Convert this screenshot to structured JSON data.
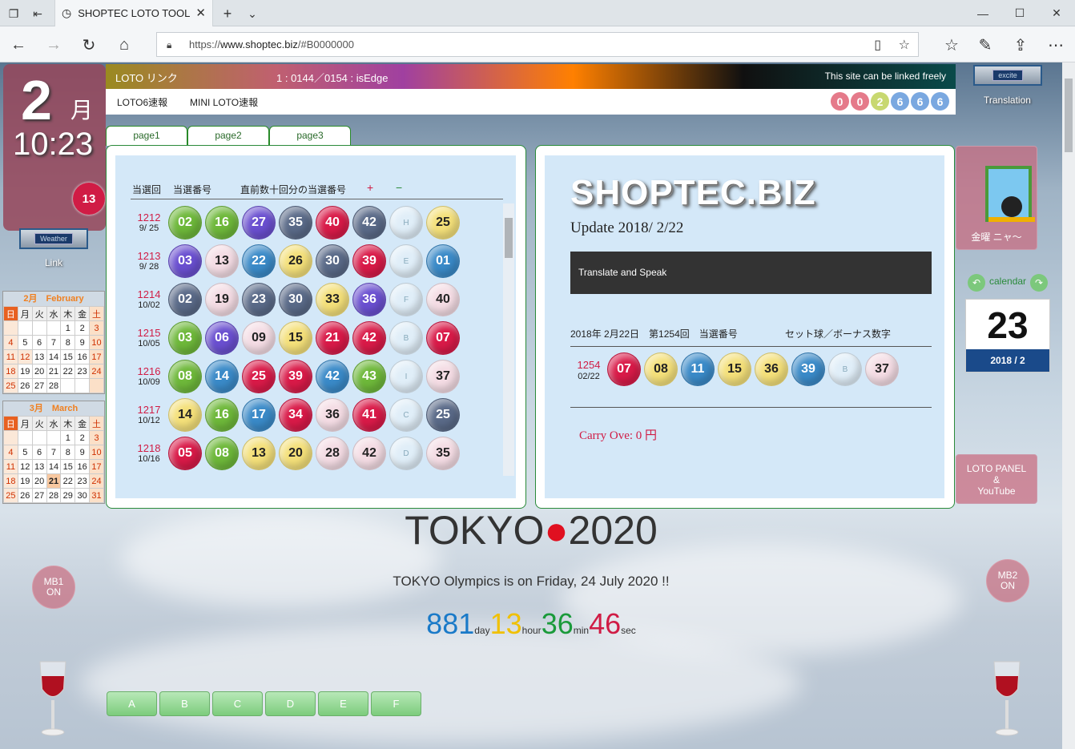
{
  "browser": {
    "tab_title": "SHOPTEC LOTO TOOL",
    "url_prefix": "https://",
    "url_host": "www.shoptec.biz",
    "url_path": "/#B0000000"
  },
  "clock": {
    "month": "2",
    "month_unit": "月",
    "time": "10:23"
  },
  "left": {
    "badge_count": "13",
    "weather_label": "Weather",
    "link_label": "Link"
  },
  "calendars": [
    {
      "header": "2月　February",
      "weekdays": [
        "日",
        "月",
        "火",
        "水",
        "木",
        "金",
        "土"
      ],
      "weeks": [
        [
          "",
          "",
          "",
          "",
          "1",
          "2",
          "3"
        ],
        [
          "4",
          "5",
          "6",
          "7",
          "8",
          "9",
          "10"
        ],
        [
          "11",
          "12",
          "13",
          "14",
          "15",
          "16",
          "17"
        ],
        [
          "18",
          "19",
          "20",
          "21",
          "22",
          "23",
          "24"
        ],
        [
          "25",
          "26",
          "27",
          "28",
          "",
          "",
          ""
        ]
      ]
    },
    {
      "header": "3月　March",
      "weekdays": [
        "日",
        "月",
        "火",
        "水",
        "木",
        "金",
        "土"
      ],
      "weeks": [
        [
          "",
          "",
          "",
          "",
          "1",
          "2",
          "3"
        ],
        [
          "4",
          "5",
          "6",
          "7",
          "8",
          "9",
          "10"
        ],
        [
          "11",
          "12",
          "13",
          "14",
          "15",
          "16",
          "17"
        ],
        [
          "18",
          "19",
          "20",
          "21",
          "22",
          "23",
          "24"
        ],
        [
          "25",
          "26",
          "27",
          "28",
          "29",
          "30",
          "31"
        ]
      ]
    }
  ],
  "top_band": {
    "link_label": "LOTO リンク",
    "status": "1 : 0144／0154 : isEdge",
    "notice": "This site can be linked freely"
  },
  "sub_band": {
    "loto6": "LOTO6速報",
    "miniloto": "MINI LOTO速報",
    "counter": [
      "0",
      "0",
      "2",
      "6",
      "6",
      "6"
    ]
  },
  "page_tabs": [
    "page1",
    "page2",
    "page3"
  ],
  "history": {
    "headers": {
      "round": "当選回",
      "numbers": "当選番号",
      "recent": "直前数十回分の当選番号",
      "plus": "+",
      "minus": "−"
    },
    "rows": [
      {
        "round": "1212",
        "date": "9/ 25",
        "balls": [
          "02",
          "16",
          "27",
          "35",
          "40",
          "42",
          "H",
          "25"
        ]
      },
      {
        "round": "1213",
        "date": "9/ 28",
        "balls": [
          "03",
          "13",
          "22",
          "26",
          "30",
          "39",
          "E",
          "01"
        ]
      },
      {
        "round": "1214",
        "date": "10/02",
        "balls": [
          "02",
          "19",
          "23",
          "30",
          "33",
          "36",
          "F",
          "40"
        ]
      },
      {
        "round": "1215",
        "date": "10/05",
        "balls": [
          "03",
          "06",
          "09",
          "15",
          "21",
          "42",
          "B",
          "07"
        ]
      },
      {
        "round": "1216",
        "date": "10/09",
        "balls": [
          "08",
          "14",
          "25",
          "39",
          "42",
          "43",
          "I",
          "37"
        ]
      },
      {
        "round": "1217",
        "date": "10/12",
        "balls": [
          "14",
          "16",
          "17",
          "34",
          "36",
          "41",
          "C",
          "25"
        ]
      },
      {
        "round": "1218",
        "date": "10/16",
        "balls": [
          "05",
          "08",
          "13",
          "20",
          "28",
          "42",
          "D",
          "35"
        ]
      }
    ]
  },
  "site": {
    "title": "SHOPTEC.BIZ",
    "update": "Update 2018/ 2/22",
    "speak": "Translate and Speak",
    "latest_header": "2018年 2月22日　第1254回　当選番号",
    "latest_header2": "セット球／ボーナス数字",
    "latest_round": "1254",
    "latest_date": "02/22",
    "latest_balls": [
      "07",
      "08",
      "11",
      "15",
      "36",
      "39",
      "B",
      "37"
    ],
    "carry": "Carry Ove: 0 円"
  },
  "tokyo": {
    "word": "TOKYO",
    "year": "2020",
    "sentence": "TOKYO Olympics is on Friday, 24 July 2020 !!",
    "days": "881",
    "day_u": "day",
    "hours": "13",
    "hour_u": "hour",
    "mins": "36",
    "min_u": "min",
    "secs": "46",
    "sec_u": "sec"
  },
  "mb": {
    "mb1": "MB1\nON",
    "mb2": "MB2\nON"
  },
  "bottom_buttons": [
    "A",
    "B",
    "C",
    "D",
    "E",
    "F"
  ],
  "right": {
    "translation": "Translation",
    "excite": "excite",
    "day_label": "金曜 ニャ〜",
    "calendar_label": "calendar",
    "big_day": "23",
    "year_month": "2018 / 2",
    "loto_panel": "LOTO PANEL\n&\nYouTube"
  }
}
